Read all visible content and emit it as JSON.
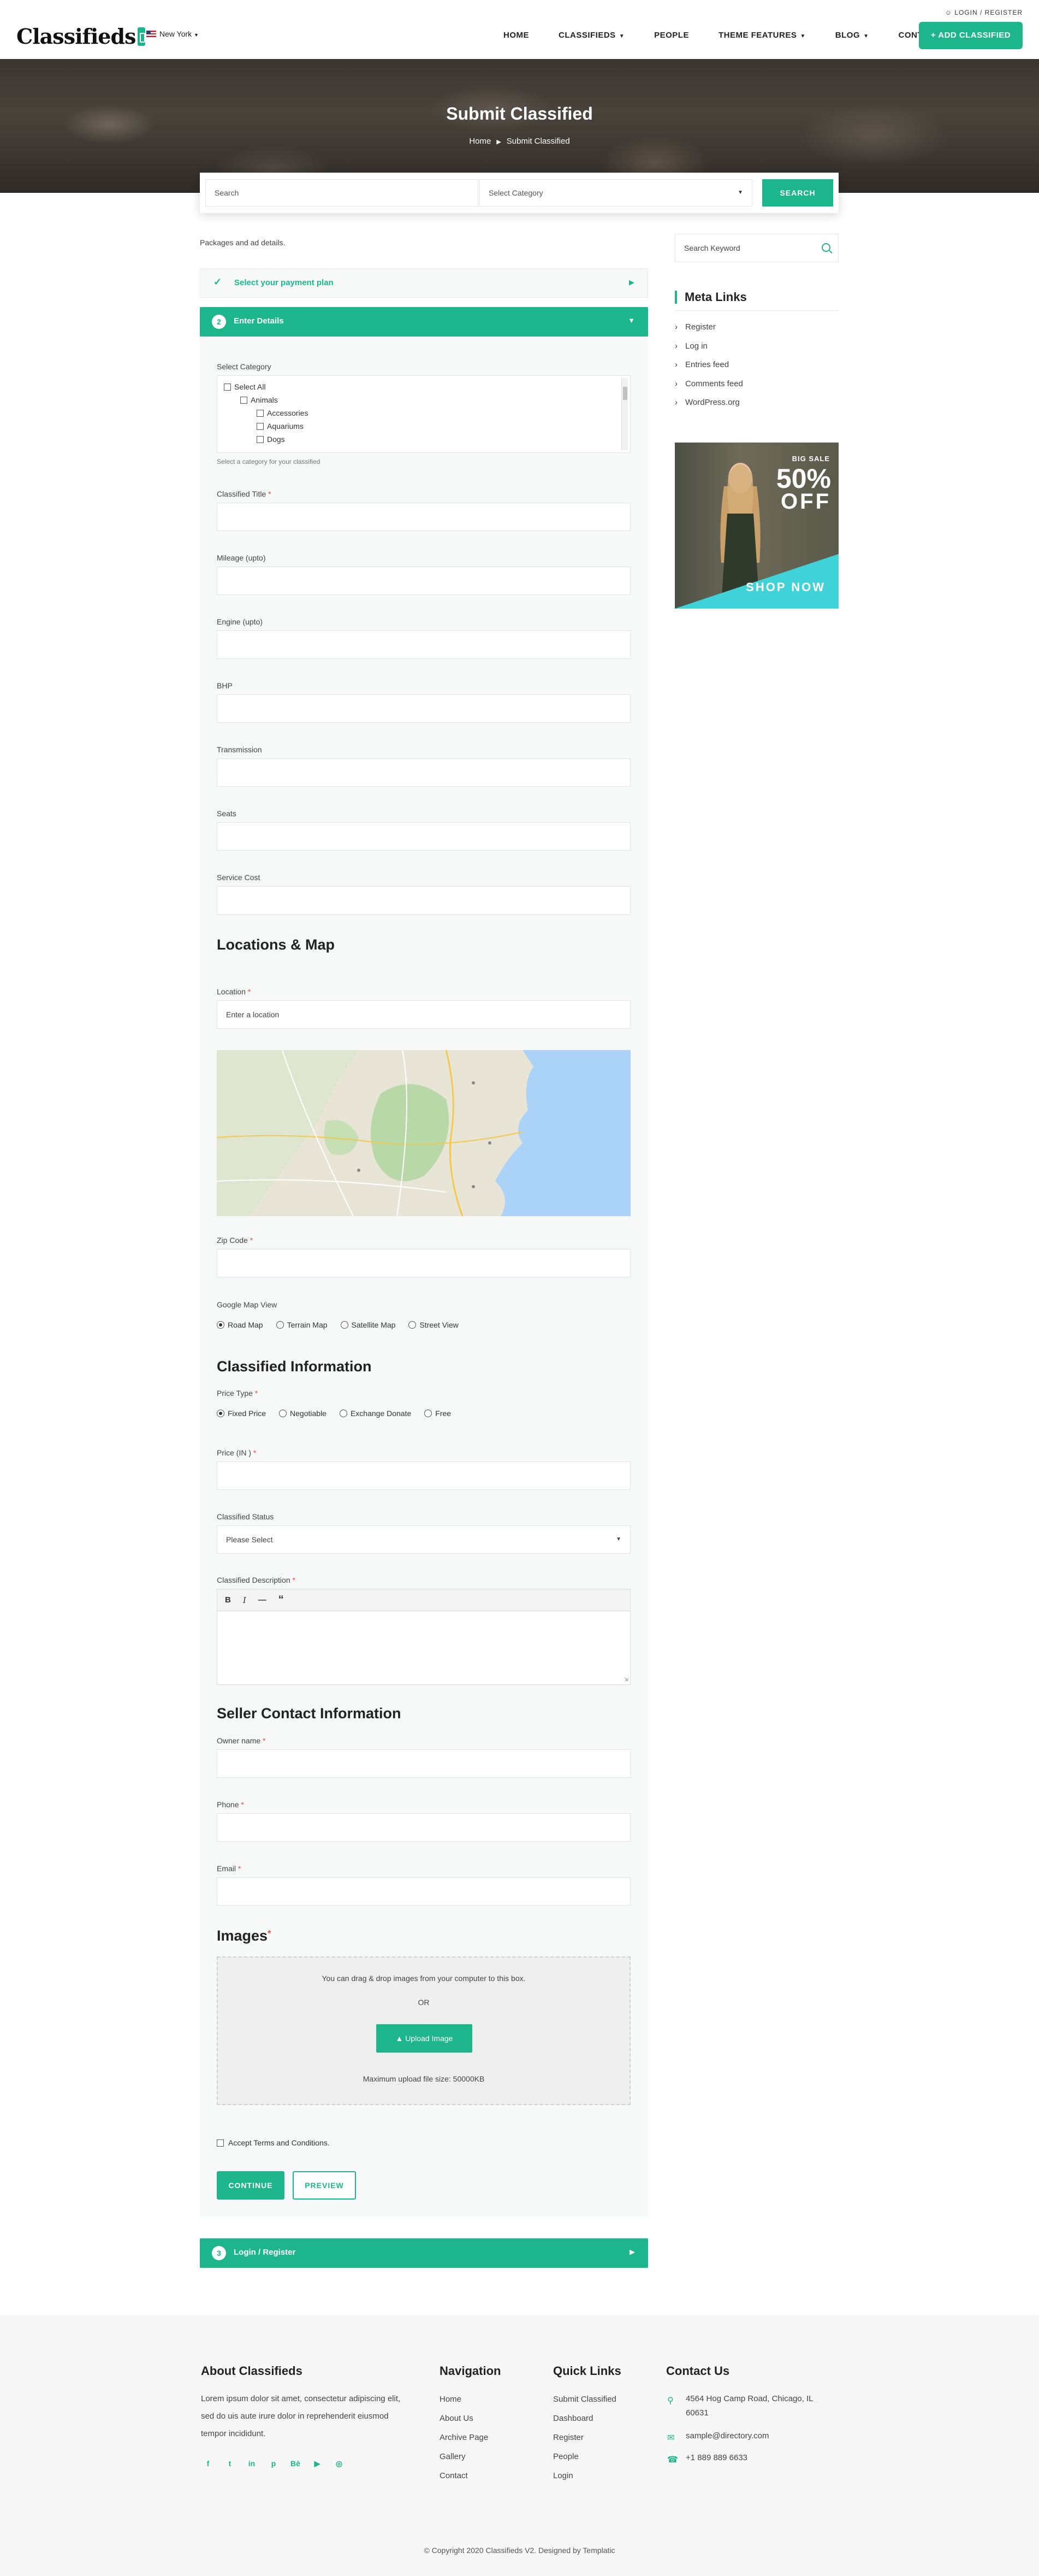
{
  "header": {
    "logo_text": "Classifieds",
    "city": "New York",
    "login_link": "LOGIN / REGISTER",
    "nav": [
      {
        "label": "HOME",
        "dropdown": false
      },
      {
        "label": "CLASSIFIEDS",
        "dropdown": true
      },
      {
        "label": "PEOPLE",
        "dropdown": false
      },
      {
        "label": "THEME FEATURES",
        "dropdown": true
      },
      {
        "label": "BLOG",
        "dropdown": true
      },
      {
        "label": "CONTACT",
        "dropdown": false
      }
    ],
    "add_button": "+ ADD CLASSIFIED"
  },
  "hero": {
    "title": "Submit Classified",
    "breadcrumb": [
      "Home",
      "Submit Classified"
    ]
  },
  "search": {
    "input_placeholder": "Search",
    "category_placeholder": "Select Category",
    "button": "SEARCH"
  },
  "main": {
    "intro": "Packages and ad details.",
    "steps": [
      {
        "label": "Select your payment plan",
        "state": "done"
      },
      {
        "number": "2",
        "label": "Enter Details",
        "state": "active"
      },
      {
        "number": "3",
        "label": "Login / Register",
        "state": "pending"
      }
    ],
    "category": {
      "label": "Select Category",
      "options": [
        "Select All",
        "Animals",
        "Accessories",
        "Aquariums",
        "Dogs"
      ],
      "hint": "Select a category for your classified"
    },
    "fields": {
      "title": "Classified Title",
      "mileage": "Mileage (upto)",
      "engine": "Engine (upto)",
      "bhp": "BHP",
      "transmission": "Transmission",
      "seats": "Seats",
      "service_cost": "Service Cost"
    },
    "location": {
      "heading": "Locations & Map",
      "label": "Location",
      "placeholder": "Enter a location",
      "zip_label": "Zip Code",
      "map_view_label": "Google Map View",
      "map_views": [
        "Road Map",
        "Terrain Map",
        "Satellite Map",
        "Street View"
      ],
      "map_view_selected": "Road Map"
    },
    "classified_info": {
      "heading": "Classified Information",
      "price_type_label": "Price Type",
      "price_types": [
        "Fixed Price",
        "Negotiable",
        "Exchange Donate",
        "Free"
      ],
      "price_type_selected": "Fixed Price",
      "price_label": "Price (IN )",
      "status_label": "Classified Status",
      "status_value": "Please Select",
      "description_label": "Classified Description",
      "editor_tools": [
        "B",
        "I",
        "—",
        "“"
      ]
    },
    "seller": {
      "heading": "Seller Contact Information",
      "owner": "Owner name",
      "phone": "Phone",
      "email": "Email"
    },
    "images": {
      "heading": "Images",
      "drag_text": "You can drag & drop images from your computer to this box.",
      "or": "OR",
      "upload_button": "Upload Image",
      "max_size": "Maximum upload file size: 50000KB"
    },
    "terms": "Accept Terms and Conditions.",
    "continue": "CONTINUE",
    "preview": "PREVIEW"
  },
  "sidebar": {
    "keyword_placeholder": "Search Keyword",
    "meta_title": "Meta Links",
    "meta_links": [
      "Register",
      "Log in",
      "Entries feed",
      "Comments feed",
      "WordPress.org"
    ],
    "ad": {
      "small": "BIG SALE",
      "big": "50%",
      "off": "OFF",
      "cta": "SHOP NOW"
    }
  },
  "footer": {
    "about": {
      "heading": "About Classifieds",
      "text": "Lorem ipsum dolor sit amet, consectetur adipiscing elit, sed do uis aute irure dolor in reprehenderit eiusmod tempor incididunt.",
      "socials": [
        "facebook-icon",
        "twitter-icon",
        "linkedin-icon",
        "pinterest-icon",
        "behance-icon",
        "youtube-icon",
        "dribbble-icon"
      ]
    },
    "navigation": {
      "heading": "Navigation",
      "links": [
        "Home",
        "About Us",
        "Archive Page",
        "Gallery",
        "Contact"
      ]
    },
    "quick_links": {
      "heading": "Quick Links",
      "links": [
        "Submit Classified",
        "Dashboard",
        "Register",
        "People",
        "Login"
      ]
    },
    "contact": {
      "heading": "Contact Us",
      "address": "4564 Hog Camp Road, Chicago, IL 60631",
      "email": "sample@directory.com",
      "phone": "+1 889 889 6633"
    },
    "copyright": "© Copyright 2020 Classifieds V2. Designed by Templatic"
  },
  "colors": {
    "accent": "#1cb58c",
    "panel": "#f7f8f8",
    "required": "#e74c3c"
  }
}
